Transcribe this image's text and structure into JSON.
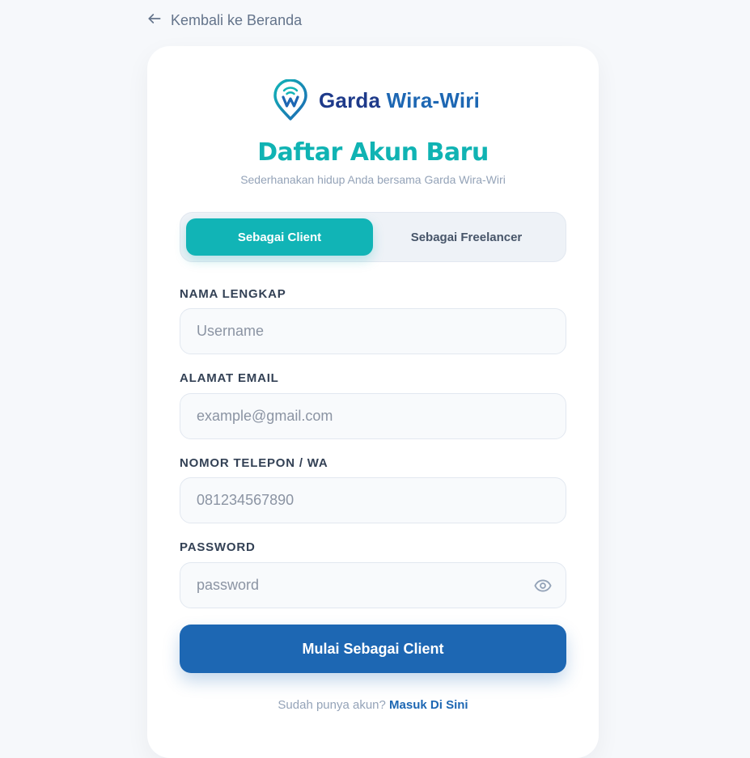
{
  "back_link": {
    "label": "Kembali ke Beranda",
    "icon": "arrow-left-icon"
  },
  "brand": {
    "part1": "Garda",
    "part2": "Wira-Wiri",
    "logo_icon": "location-pin-w-logo"
  },
  "heading": {
    "title": "Daftar Akun Baru",
    "subtitle": "Sederhanakan hidup Anda bersama Garda Wira-Wiri"
  },
  "tabs": [
    {
      "label": "Sebagai Client",
      "active": true
    },
    {
      "label": "Sebagai Freelancer",
      "active": false
    }
  ],
  "form": {
    "name": {
      "label": "NAMA LENGKAP",
      "placeholder": "Username",
      "value": ""
    },
    "email": {
      "label": "ALAMAT EMAIL",
      "placeholder": "example@gmail.com",
      "value": ""
    },
    "phone": {
      "label": "NOMOR TELEPON / WA",
      "placeholder": "081234567890",
      "value": ""
    },
    "password": {
      "label": "PASSWORD",
      "placeholder": "password",
      "value": "",
      "toggle_icon": "eye-icon"
    },
    "submit_label": "Mulai Sebagai Client"
  },
  "footer": {
    "text": "Sudah punya akun?",
    "link": "Masuk Di Sini"
  },
  "colors": {
    "background": "#f6f8fb",
    "accent_teal": "#11b4b6",
    "primary_blue": "#1d67b3",
    "brand_navy": "#1e3a8a"
  }
}
